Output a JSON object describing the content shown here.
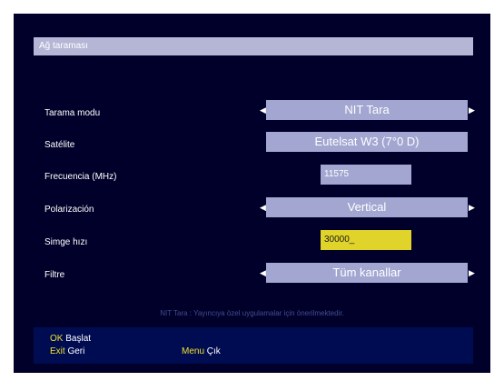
{
  "header": {
    "title": "Ağ taraması"
  },
  "fields": {
    "scan_mode": {
      "label": "Tarama modu",
      "value": "NIT Tara"
    },
    "satellite": {
      "label": "Satélite",
      "value": "Eutelsat W3 (7°0 D)"
    },
    "frequency": {
      "label": "Frecuencia (MHz)",
      "value": "11575"
    },
    "polarization": {
      "label": "Polarización",
      "value": "Vertical"
    },
    "symbol_rate": {
      "label": "Simge hızı",
      "value": "30000_"
    },
    "filter": {
      "label": "Filtre",
      "value": "Tüm kanallar"
    }
  },
  "hint": "NIT Tara : Yayıncıya özel uygulamalar için önerilmektedir.",
  "help": {
    "ok_key": "OK",
    "ok_action": "Başlat",
    "exit_key": "Exit",
    "exit_action": "Geri",
    "menu_key": "Menu",
    "menu_action": "Çık"
  },
  "colors": {
    "background": "#01002a",
    "field": "#a2a6d0",
    "highlight": "#e0d32a",
    "key": "#f0e12a"
  }
}
